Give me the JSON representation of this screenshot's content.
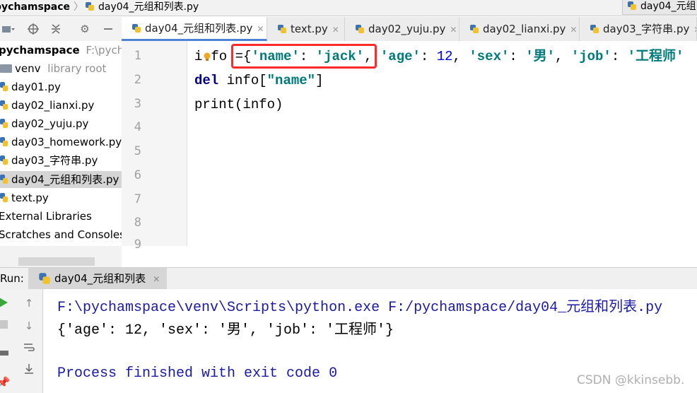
{
  "breadcrumb": {
    "project": "pychamspace",
    "file": "day04_元组和列表.py"
  },
  "top_right_tab": "day04_元组",
  "project_panel": {
    "root": {
      "name": "pychamspace",
      "path": "F:\\pychar"
    },
    "items": [
      {
        "label": "venv",
        "note": "library root",
        "type": "folder"
      },
      {
        "label": "day01.py",
        "type": "file"
      },
      {
        "label": "day02_lianxi.py",
        "type": "file"
      },
      {
        "label": "day02_yuju.py",
        "type": "file"
      },
      {
        "label": "day03_homework.py",
        "type": "file"
      },
      {
        "label": "day03_字符串.py",
        "type": "file"
      },
      {
        "label": "day04_元组和列表.py",
        "type": "file",
        "selected": true
      },
      {
        "label": "text.py",
        "type": "file"
      },
      {
        "label": "External Libraries",
        "type": "lib"
      },
      {
        "label": "Scratches and Consoles",
        "type": "scratch"
      }
    ]
  },
  "tabs": [
    {
      "label": "day04_元组和列表.py",
      "active": true
    },
    {
      "label": "text.py"
    },
    {
      "label": "day02_yuju.py"
    },
    {
      "label": "day02_lianxi.py"
    },
    {
      "label": "day03_字符串.py"
    }
  ],
  "editor": {
    "line_numbers": [
      "1",
      "2",
      "3",
      "4",
      "5",
      "6",
      "7",
      "8",
      "9"
    ],
    "code": {
      "l1": {
        "var": "i",
        "var2": "fo",
        "assign": " ={",
        "k1": "'name'",
        "c1": ": ",
        "v1": "'jack'",
        "sep1": ", ",
        "k2": "'age'",
        "c2": ": ",
        "v2": "12",
        "sep2": ", ",
        "k3": "'sex'",
        "c3": ": ",
        "v3": "'男'",
        "sep3": ", ",
        "k4": "'job'",
        "c4": ": ",
        "v4": "'工程师'"
      },
      "l2": {
        "kw": "del",
        "rest": " info[",
        "key": "\"name\"",
        "close": "]"
      },
      "l3": {
        "call": "print(info)"
      }
    },
    "highlight_color": "#ff2b2b"
  },
  "run_panel": {
    "label": "Run:",
    "tab": "day04_元组和列表",
    "console": {
      "cmd": "F:\\pychamspace\\venv\\Scripts\\python.exe F:/pychamspace/day04_元组和列表.py",
      "output": "{'age': 12, 'sex': '男', 'job': '工程师'}",
      "exit": "Process finished with exit code 0"
    }
  },
  "watermark": "CSDN @kkinsebb.",
  "icons": [
    "python-file-icon",
    "folder-icon",
    "gear-icon",
    "target-icon",
    "collapse-icon",
    "minimize-icon",
    "run-icon",
    "stop-icon",
    "rerun-icon",
    "scroll-down-icon",
    "wrap-icon",
    "pin-icon",
    "bulb-icon",
    "close-icon"
  ],
  "colors": {
    "accent": "#4d84d6",
    "keyword": "#000080",
    "string": "#007a7a",
    "number": "#0000ff",
    "console_text": "#1a1aa6",
    "current_line": "#fffae3"
  }
}
